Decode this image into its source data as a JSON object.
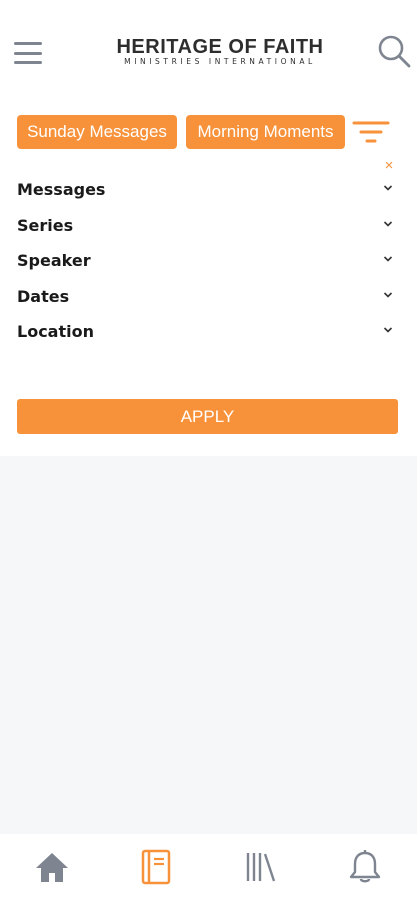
{
  "header": {
    "logo_main": "HERITAGE OF FAITH",
    "logo_sub": "MINISTRIES INTERNATIONAL",
    "menu_icon": "hamburger-icon",
    "search_icon": "search-icon"
  },
  "category_chips": [
    {
      "label": "Sunday Messages"
    },
    {
      "label": "Morning Moments"
    }
  ],
  "filter_panel": {
    "close_symbol": "×",
    "filters": [
      {
        "label": "Messages"
      },
      {
        "label": "Series"
      },
      {
        "label": "Speaker"
      },
      {
        "label": "Dates"
      },
      {
        "label": "Location"
      }
    ],
    "apply_label": "APPLY"
  },
  "bottom_nav": [
    {
      "icon": "home-icon"
    },
    {
      "icon": "book-icon",
      "active": true
    },
    {
      "icon": "library-icon"
    },
    {
      "icon": "bell-icon"
    }
  ],
  "colors": {
    "accent": "#f7923a",
    "icon_gray": "#7e8590",
    "background": "#f6f7f9"
  }
}
